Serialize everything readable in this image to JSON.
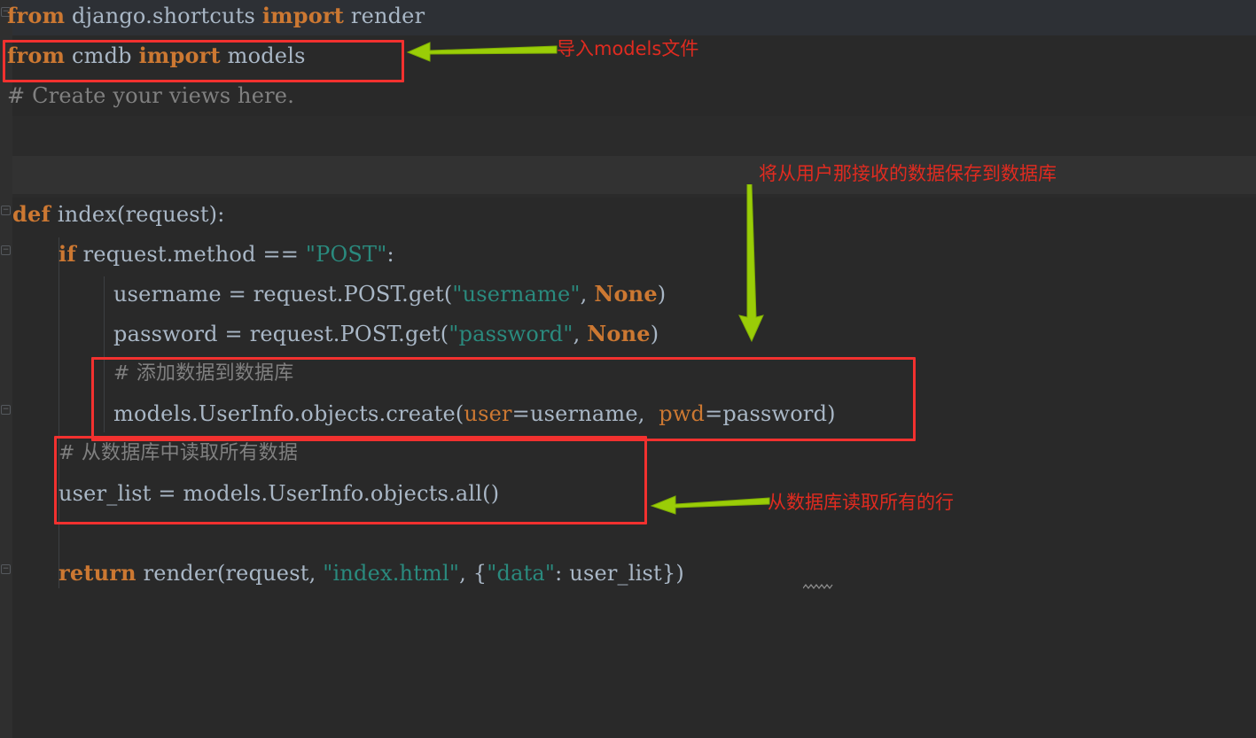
{
  "editor": {
    "background_color": "#292929",
    "gutter_color": "#2f2f2f",
    "default_text_color": "#a9b7c6",
    "keyword_color": "#cc7832",
    "string_color": "#2a8a7e",
    "comment_color": "#808080",
    "highlight_band_color": "#323232",
    "current_line_band_color": "#2d3035"
  },
  "code": {
    "line1": {
      "kw_from": "from",
      "module": " django.shortcuts ",
      "kw_import": "import",
      "target": " render"
    },
    "line2": {
      "kw_from": "from",
      "module": " cmdb ",
      "kw_import": "import",
      "target": " models"
    },
    "line3": {
      "comment": "# Create your views here."
    },
    "line4": {
      "kw_def": "def",
      "signature": " index(request):"
    },
    "line5": {
      "kw_if": "if",
      "expr": " request.method == ",
      "string": "\"POST\"",
      "colon": ":"
    },
    "line6": {
      "lhs": "username = request.POST.get(",
      "string": "\"username\"",
      "comma": ", ",
      "none": "None",
      "close": ")"
    },
    "line7": {
      "lhs": "password = request.POST.get(",
      "string": "\"password\"",
      "comma": ", ",
      "none": "None",
      "close": ")"
    },
    "line8": {
      "comment": "# 添加数据到数据库"
    },
    "line9": {
      "call": "models.UserInfo.objects.create(",
      "kwarg1": "user",
      "eq1": "=username, ",
      "kwarg2": " pwd",
      "eq2": "=password)"
    },
    "line10": {
      "comment": "# 从数据库中读取所有数据"
    },
    "line11": {
      "text": "user_list = models.UserInfo.objects.all()"
    },
    "line12": {
      "kw_return": "return",
      "call": " render(request, ",
      "string1": "\"index.html\"",
      "mid": ", {",
      "string2": "\"data\"",
      "tail": ": user_list})"
    }
  },
  "annotations": {
    "color": "#e02b20",
    "arrow_color": "#9acd07",
    "box_color": "#f2312f",
    "items": [
      {
        "id": "import-models",
        "label": "导入models文件",
        "arrow": "left-arrow-icon",
        "boxed_code": "from cmdb import models"
      },
      {
        "id": "save-received-data",
        "label": "将从用户那接收的数据保存到数据库",
        "arrow": "down-arrow-icon",
        "boxed_code": "# 添加数据到数据库 / models.UserInfo.objects.create(user=username, pwd=password)"
      },
      {
        "id": "read-all-rows",
        "label": "从数据库读取所有的行",
        "arrow": "left-arrow-icon",
        "boxed_code": "# 从数据库中读取所有数据 / user_list = models.UserInfo.objects.all()"
      }
    ]
  },
  "gutter": {
    "fold_markers": [
      "-",
      "-",
      "-",
      "-"
    ]
  }
}
